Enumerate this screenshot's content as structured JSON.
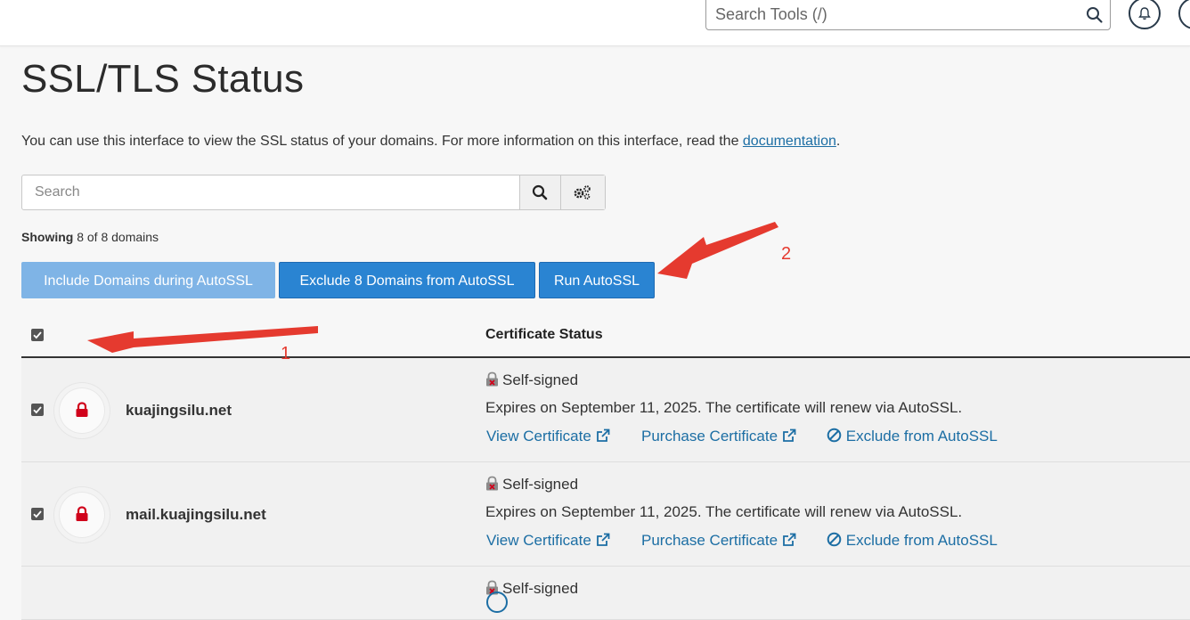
{
  "topbar": {
    "tool_search_placeholder": "Search Tools (/)"
  },
  "page": {
    "title": "SSL/TLS Status",
    "description_before": "You can use this interface to view the SSL status of your domains. For more information on this interface, read the ",
    "description_link": "documentation",
    "description_after": "."
  },
  "search": {
    "placeholder": "Search"
  },
  "showing": {
    "bold": "Showing",
    "rest": " 8 of 8 domains"
  },
  "actions": {
    "include_label": "Include Domains during AutoSSL",
    "exclude_label": "Exclude 8 Domains from AutoSSL",
    "run_label": "Run AutoSSL"
  },
  "table": {
    "header_status": "Certificate Status",
    "rows": [
      {
        "domain": "kuajingsilu.net",
        "status": "Self-signed",
        "expires": "Expires on September 11, 2025. The certificate will renew via AutoSSL.",
        "view_label": "View Certificate",
        "purchase_label": "Purchase Certificate",
        "exclude_label": "Exclude from AutoSSL"
      },
      {
        "domain": "mail.kuajingsilu.net",
        "status": "Self-signed",
        "expires": "Expires on September 11, 2025. The certificate will renew via AutoSSL.",
        "view_label": "View Certificate",
        "purchase_label": "Purchase Certificate",
        "exclude_label": "Exclude from AutoSSL"
      },
      {
        "status": "Self-signed"
      }
    ]
  },
  "annotations": {
    "label_1": "1",
    "label_2": "2",
    "arrow_color": "#e53a2f"
  },
  "colors": {
    "primary_button": "#2a84d2",
    "disabled_button": "#7fb4e6",
    "link": "#1c6ea4",
    "lock_red": "#d0021b"
  },
  "icons": {
    "tool_search": "magnifier-icon",
    "notifications": "bell-icon",
    "search": "magnifier-icon",
    "settings": "gears-icon",
    "domain_status": "red-lock-icon",
    "cert_status": "broken-lock-icon",
    "external": "external-link-icon",
    "exclude": "ban-icon"
  }
}
